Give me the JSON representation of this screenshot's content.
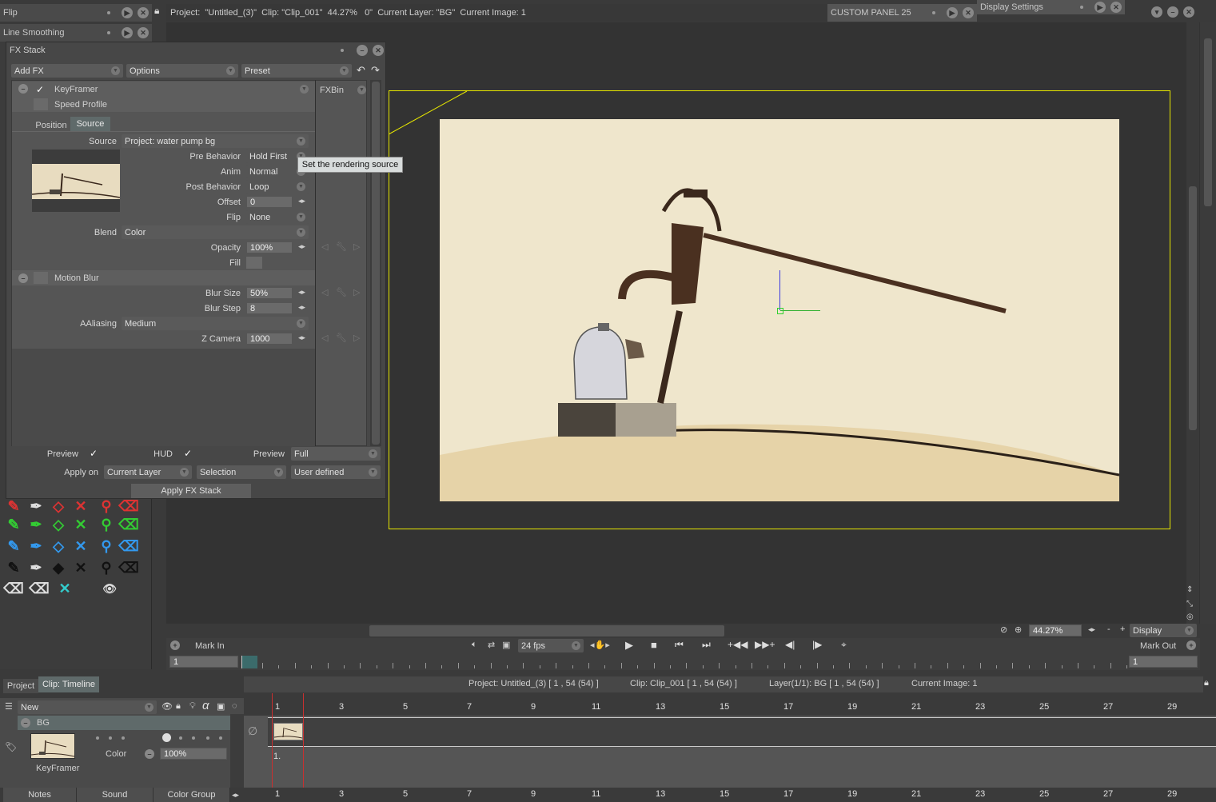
{
  "top_left_panels": {
    "flip_label": "Flip",
    "line_smoothing_label": "Line Smoothing"
  },
  "info_bar": {
    "text": "Project:  \"Untitled_(3)\"  Clip: \"Clip_001\"  44.27%   0\"  Current Layer: \"BG\"  Current Image: 1"
  },
  "custom_panel": {
    "label": "CUSTOM PANEL 25"
  },
  "display_settings": {
    "label": "Display Settings"
  },
  "fx_stack": {
    "title": "FX Stack",
    "add_fx": "Add FX",
    "options": "Options",
    "preset": "Preset",
    "fxbin": "FXBin",
    "keyframer": "KeyFramer",
    "speed_profile": "Speed Profile",
    "tab_position": "Position",
    "tab_source": "Source",
    "source_label": "Source",
    "source_value": "Project: water pump bg",
    "pre_behavior_label": "Pre Behavior",
    "pre_behavior_value": "Hold First",
    "anim_label": "Anim",
    "anim_value": "Normal",
    "post_behavior_label": "Post Behavior",
    "post_behavior_value": "Loop",
    "offset_label": "Offset",
    "offset_value": "0",
    "flip_label": "Flip",
    "flip_value": "None",
    "blend_label": "Blend",
    "blend_value": "Color",
    "opacity_label": "Opacity",
    "opacity_value": "100%",
    "fill_label": "Fill",
    "motion_blur": "Motion Blur",
    "blur_size_label": "Blur Size",
    "blur_size_value": "50%",
    "blur_step_label": "Blur Step",
    "blur_step_value": "8",
    "aaliasing_label": "AAliasing",
    "aaliasing_value": "Medium",
    "z_camera_label": "Z Camera",
    "z_camera_value": "1000",
    "tooltip": "Set the rendering source",
    "preview_label": "Preview",
    "hud_label": "HUD",
    "preview2_label": "Preview",
    "preview2_value": "Full",
    "apply_on_label": "Apply on",
    "apply_on_value": "Current Layer",
    "selection_value": "Selection",
    "user_defined_value": "User defined",
    "apply_button": "Apply FX Stack"
  },
  "viewer_controls": {
    "zoom_value": "44.27%",
    "minus": "-",
    "plus": "+",
    "display": "Display",
    "mark_in": "Mark In",
    "mark_out": "Mark Out",
    "fps": "24 fps",
    "in_frame": "1",
    "out_frame": "1"
  },
  "timeline": {
    "tab_project": "Project",
    "tab_clip": "Clip: Timeline",
    "status_project": "Project: Untitled_(3) [ 1 , 54  (54) ]",
    "status_clip": "Clip: Clip_001 [ 1 , 54  (54) ]",
    "status_layer": "Layer(1/1): BG [ 1 , 54  (54) ]",
    "status_image": "Current Image: 1",
    "new_label": "New",
    "layer_name": "BG",
    "layer_blend": "Color",
    "layer_opacity": "100%",
    "layer_fx": "KeyFramer",
    "cell_label": "1.",
    "frame_numbers": [
      "1",
      "3",
      "5",
      "7",
      "9",
      "11",
      "13",
      "15",
      "17",
      "19",
      "21",
      "23",
      "25",
      "27",
      "29"
    ]
  },
  "bottom_tabs": {
    "notes": "Notes",
    "sound": "Sound",
    "color_group": "Color Group"
  },
  "colors": {
    "camera_frame": "#e6e600",
    "canvas_bg": "#efe6cc",
    "playhead": "#c83030"
  }
}
